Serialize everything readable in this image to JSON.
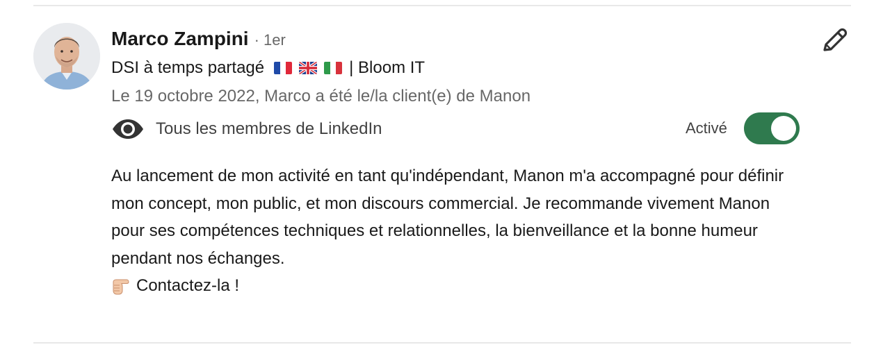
{
  "recommendation": {
    "author": {
      "name": "Marco Zampini",
      "degree": "· 1er",
      "headline_prefix": "DSI à temps partagé",
      "headline_suffix": "| Bloom IT",
      "flags": [
        "flag-france-icon",
        "flag-uk-icon",
        "flag-italy-icon"
      ],
      "avatar_icon": "profile-photo"
    },
    "relation": "Le 19 octobre 2022, Marco a été le/la client(e) de Manon",
    "visibility": {
      "icon": "eye-icon",
      "label": "Tous les membres de LinkedIn"
    },
    "toggle": {
      "label": "Activé",
      "state": "on",
      "color": "#2f7a4e"
    },
    "edit_icon": "pencil-icon",
    "text": "Au lancement de mon activité en tant qu'indépendant, Manon m'a accompagné pour définir mon concept, mon public, et mon discours commercial. Je recommande vivement Manon pour ses compétences techniques et relationnelles, la bienveillance et la bonne humeur pendant nos échanges.",
    "cta": {
      "icon": "pointing-hand-icon",
      "text": "Contactez-la !"
    }
  }
}
